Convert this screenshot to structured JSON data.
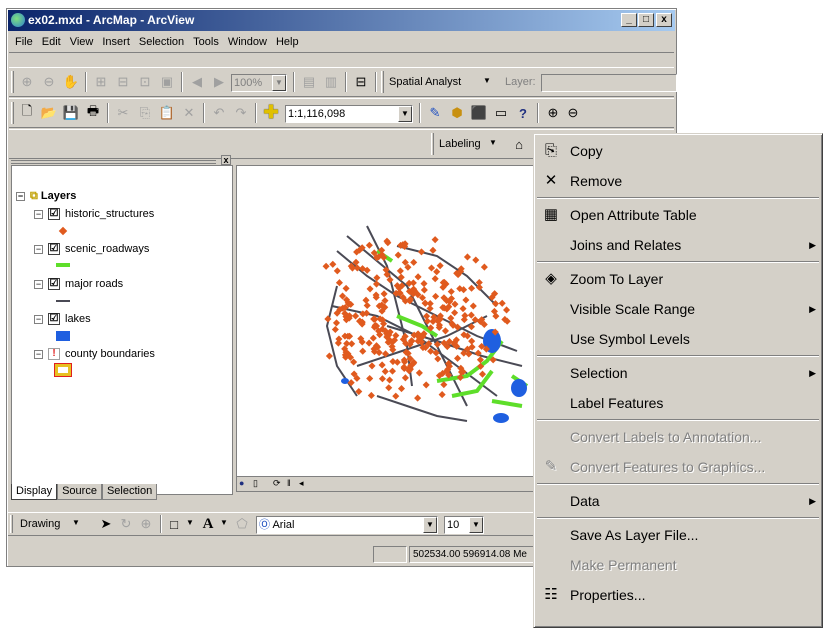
{
  "window": {
    "title": "ex02.mxd - ArcMap - ArcView",
    "min": "_",
    "max": "□",
    "close": "x"
  },
  "menu": [
    "File",
    "Edit",
    "View",
    "Insert",
    "Selection",
    "Tools",
    "Window",
    "Help"
  ],
  "toolbar": {
    "zoom_combo": "100%",
    "spatial_analyst": "Spatial Analyst",
    "layer_label": "Layer:",
    "scale": "1:1,116,098",
    "labeling": "Labeling"
  },
  "toc": {
    "root": "Layers",
    "layers": [
      {
        "name": "historic_structures",
        "checked": "☑"
      },
      {
        "name": "scenic_roadways",
        "checked": "☑"
      },
      {
        "name": "major roads",
        "checked": "☑"
      },
      {
        "name": "lakes",
        "checked": "☑"
      },
      {
        "name": "county boundaries",
        "checked": "!"
      }
    ],
    "tabs": [
      "Display",
      "Source",
      "Selection"
    ]
  },
  "drawing_toolbar": {
    "drawing": "Drawing",
    "font": "Arial",
    "font_size": "10",
    "bold_letter": "A"
  },
  "status": {
    "coords": "502534.00 596914.08 Me"
  },
  "context_menu": [
    {
      "label": "Copy",
      "icon": "copy-icon",
      "glyph": "⎘",
      "disabled": false,
      "submenu": false
    },
    {
      "label": "Remove",
      "icon": "remove-icon",
      "glyph": "✕",
      "disabled": false,
      "submenu": false
    },
    {
      "label": "Open Attribute Table",
      "icon": "table-icon",
      "glyph": "▦",
      "disabled": false,
      "submenu": false
    },
    {
      "label": "Joins and Relates",
      "icon": "",
      "glyph": "",
      "disabled": false,
      "submenu": true
    },
    {
      "label": "Zoom To Layer",
      "icon": "zoom-layer-icon",
      "glyph": "◈",
      "disabled": false,
      "submenu": false
    },
    {
      "label": "Visible Scale Range",
      "icon": "",
      "glyph": "",
      "disabled": false,
      "submenu": true
    },
    {
      "label": "Use Symbol Levels",
      "icon": "",
      "glyph": "",
      "disabled": false,
      "submenu": false
    },
    {
      "label": "Selection",
      "icon": "",
      "glyph": "",
      "disabled": false,
      "submenu": true
    },
    {
      "label": "Label Features",
      "icon": "",
      "glyph": "",
      "disabled": false,
      "submenu": false
    },
    {
      "label": "Convert Labels to Annotation...",
      "icon": "",
      "glyph": "",
      "disabled": true,
      "submenu": false
    },
    {
      "label": "Convert Features to Graphics...",
      "icon": "convert-graphics-icon",
      "glyph": "✎",
      "disabled": true,
      "submenu": false
    },
    {
      "label": "Data",
      "icon": "",
      "glyph": "",
      "disabled": false,
      "submenu": true
    },
    {
      "label": "Save As Layer File...",
      "icon": "",
      "glyph": "",
      "disabled": false,
      "submenu": false
    },
    {
      "label": "Make Permanent",
      "icon": "",
      "glyph": "",
      "disabled": true,
      "submenu": false
    },
    {
      "label": "Properties...",
      "icon": "properties-icon",
      "glyph": "☷",
      "disabled": false,
      "submenu": false
    }
  ],
  "colors": {
    "title_start": "#0a246a",
    "title_end": "#a6caf0",
    "points": "#e05a1e",
    "scenic": "#5ede2a",
    "roads": "#4a4a55",
    "lakes": "#1f5fe0",
    "county_outline": "#e8c020",
    "county_border": "#e02020"
  }
}
